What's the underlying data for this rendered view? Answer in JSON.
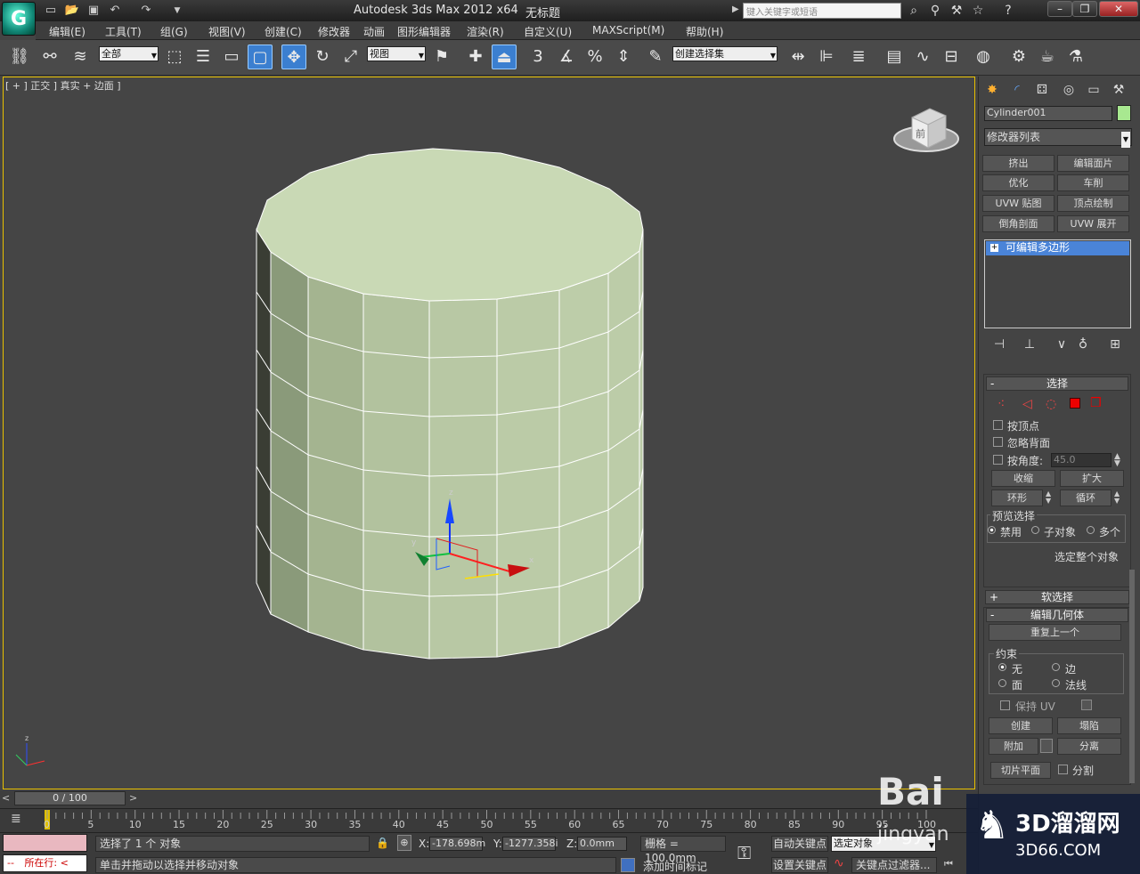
{
  "titlebar": {
    "logo": "G",
    "app_title": "Autodesk 3ds Max  2012 x64",
    "doc_name": "无标题",
    "search_placeholder": "键入关键字或短语"
  },
  "menus": [
    "编辑(E)",
    "工具(T)",
    "组(G)",
    "视图(V)",
    "创建(C)",
    "修改器",
    "动画",
    "图形编辑器",
    "渲染(R)",
    "自定义(U)",
    "MAXScript(M)",
    "帮助(H)"
  ],
  "toolbar": {
    "filter_value": "全部",
    "refcoord_value": "视图",
    "selset_value": "创建选择集",
    "snap_label": "3"
  },
  "viewport": {
    "label": "[ + ] 正交 ] 真实 + 边面 ]",
    "viewcube_face": "前",
    "gizmo": {
      "x": "x",
      "y": "y",
      "z": "z"
    }
  },
  "panel": {
    "object_name": "Cylinder001",
    "object_color": "#a8e890",
    "modifier_list": "修改器列表",
    "mod_buttons": [
      "挤出",
      "编辑面片",
      "优化",
      "车削",
      "UVW 贴图",
      "顶点绘制",
      "倒角剖面",
      "UVW 展开"
    ],
    "stack_item": "可编辑多边形",
    "selection": {
      "title": "选择",
      "by_vertex": "按顶点",
      "ignore_back": "忽略背面",
      "by_angle": "按角度:",
      "angle_value": "45.0",
      "shrink": "收缩",
      "grow": "扩大",
      "ring": "环形",
      "loop": "循环",
      "preview_title": "预览选择",
      "preview_off": "禁用",
      "preview_sub": "子对象",
      "preview_multi": "多个",
      "select_whole": "选定整个对象"
    },
    "soft_select": "软选择",
    "edit_geom": {
      "title": "编辑几何体",
      "repeat_last": "重复上一个",
      "constraints": "约束",
      "c_none": "无",
      "c_edge": "边",
      "c_face": "面",
      "c_normal": "法线",
      "preserve_uv": "保持 UV",
      "create": "创建",
      "collapse": "塌陷",
      "attach": "附加",
      "detach": "分离",
      "slice_plane": "切片平面",
      "split": "分割"
    }
  },
  "timeline": {
    "slider_text": "0 / 100",
    "ticks": [
      "0",
      "5",
      "10",
      "15",
      "20",
      "25",
      "30",
      "35",
      "40",
      "45",
      "50",
      "55",
      "60",
      "65",
      "70",
      "75",
      "80",
      "85",
      "90",
      "95",
      "100"
    ]
  },
  "status": {
    "running": "所在行:",
    "selected": "选择了 1 个 对象",
    "prompt": "单击并拖动以选择并移动对象",
    "x_label": "X:",
    "x_value": "-178.698m",
    "y_label": "Y:",
    "y_value": "-1277.358i",
    "z_label": "Z:",
    "z_value": "0.0mm",
    "grid": "栅格 = 100.0mm",
    "add_time_tag": "添加时间标记",
    "auto_key": "自动关键点",
    "set_key": "设置关键点",
    "key_mode": "选定对象",
    "key_filters": "关键点过滤器..."
  },
  "watermarks": {
    "baidu": "Bai",
    "jingyan": "jingyan",
    "site_title": "3D溜溜网",
    "site_url": "3D66.COM"
  }
}
